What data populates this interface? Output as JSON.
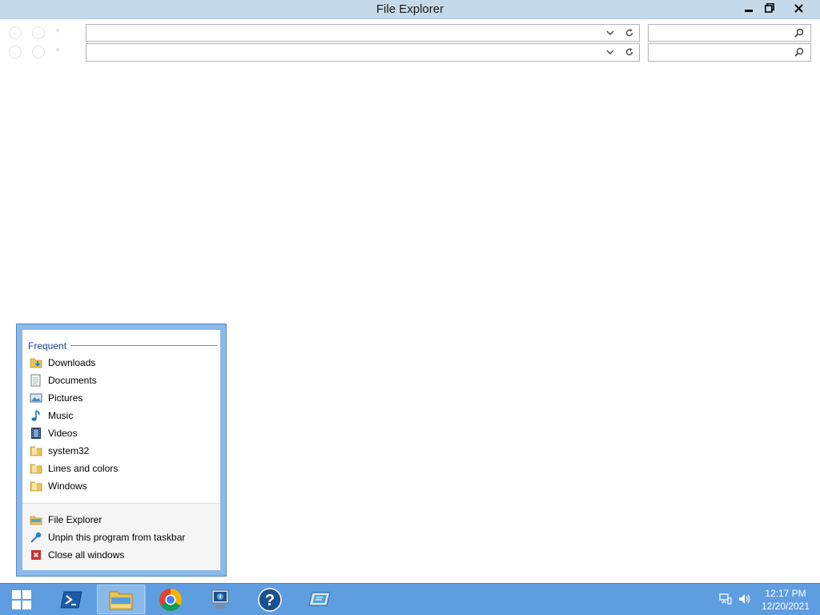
{
  "window": {
    "title": "File Explorer"
  },
  "jumplist": {
    "section_header": "Frequent",
    "frequent": [
      {
        "label": "Downloads",
        "icon": "downloads-folder-icon"
      },
      {
        "label": "Documents",
        "icon": "documents-icon"
      },
      {
        "label": "Pictures",
        "icon": "pictures-icon"
      },
      {
        "label": "Music",
        "icon": "music-icon"
      },
      {
        "label": "Videos",
        "icon": "videos-icon"
      },
      {
        "label": "system32",
        "icon": "folder-icon"
      },
      {
        "label": "Lines and colors",
        "icon": "folder-icon"
      },
      {
        "label": "Windows",
        "icon": "folder-icon"
      }
    ],
    "tasks": [
      {
        "label": "File Explorer",
        "icon": "file-explorer-icon"
      },
      {
        "label": "Unpin this program from taskbar",
        "icon": "unpin-icon"
      },
      {
        "label": "Close all windows",
        "icon": "close-red-icon"
      }
    ]
  },
  "taskbar": {
    "items": [
      "start-button",
      "powershell",
      "file-explorer",
      "chrome",
      "server-manager",
      "help",
      "remote-desktop"
    ],
    "clock_time": "12:17 PM",
    "clock_date": "12/20/2021"
  },
  "colors": {
    "taskbar": "#5e9ee0",
    "titlebar": "#c5d9e9",
    "jumplist_frame": "#8ab9ea",
    "header_text": "#1e3f8a"
  }
}
